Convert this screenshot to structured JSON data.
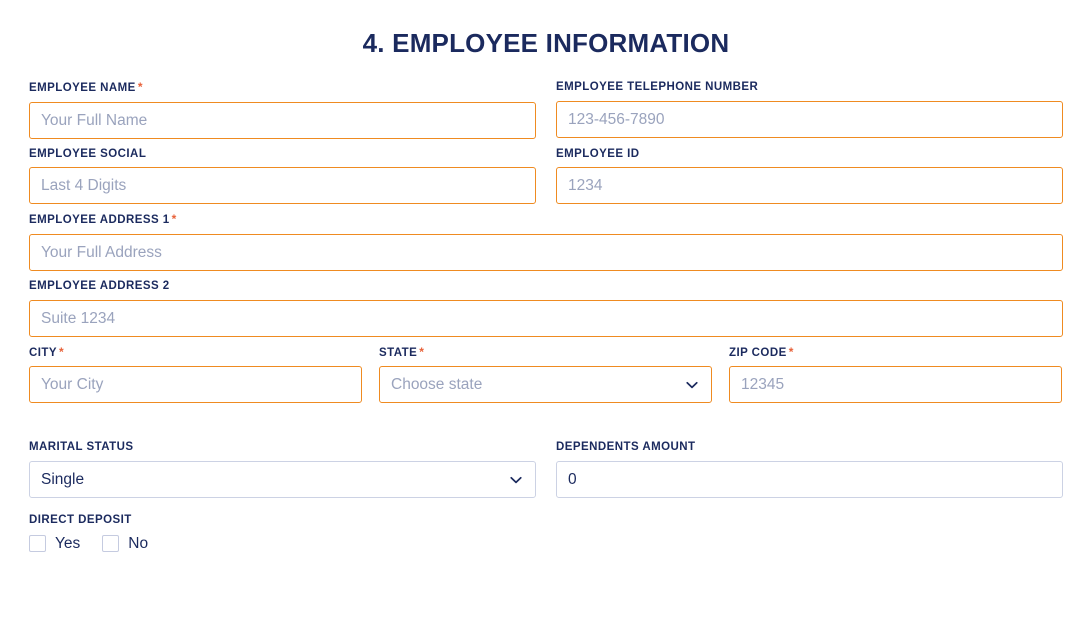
{
  "form": {
    "title": "4. EMPLOYEE INFORMATION",
    "required_marker": "*",
    "colors": {
      "title": "#1b2a5e",
      "label": "#1b2a5e",
      "required_asterisk": "#e8623a",
      "input_border_orange": "#ef8b21",
      "input_border_neutral": "#ccd2e4",
      "placeholder": "#9aa3bd",
      "value_text": "#1b2a5e"
    },
    "rows": [
      {
        "fields": [
          {
            "name": "employee-name",
            "label": "EMPLOYEE NAME",
            "required": true,
            "placeholder": "Your Full Name",
            "value": ""
          },
          {
            "name": "employee-telephone-number",
            "label": "EMPLOYEE TELEPHONE NUMBER",
            "required": false,
            "placeholder": "123-456-7890",
            "value": ""
          }
        ]
      },
      {
        "fields": [
          {
            "name": "employee-social",
            "label": "EMPLOYEE SOCIAL",
            "required": false,
            "placeholder": "Last 4 Digits",
            "value": ""
          },
          {
            "name": "employee-id",
            "label": "EMPLOYEE ID",
            "required": false,
            "placeholder": "1234",
            "value": ""
          }
        ]
      },
      {
        "fields": [
          {
            "name": "employee-address-1",
            "label": "EMPLOYEE ADDRESS 1",
            "required": true,
            "placeholder": "Your Full Address",
            "value": ""
          }
        ]
      },
      {
        "fields": [
          {
            "name": "employee-address-2",
            "label": "EMPLOYEE ADDRESS 2",
            "required": false,
            "placeholder": "Suite 1234",
            "value": ""
          }
        ]
      },
      {
        "fields": [
          {
            "name": "city",
            "label": "CITY",
            "required": true,
            "placeholder": "Your City",
            "value": ""
          },
          {
            "name": "state",
            "label": "STATE",
            "required": true,
            "placeholder": "Choose state",
            "value": ""
          },
          {
            "name": "zip-code",
            "label": "ZIP CODE",
            "required": true,
            "placeholder": "12345",
            "value": ""
          }
        ]
      },
      {
        "fields": [
          {
            "name": "marital-status",
            "label": "MARITAL STATUS",
            "required": false,
            "placeholder": "",
            "value": "Single"
          },
          {
            "name": "dependents-amount",
            "label": "DEPENDENTS AMOUNT",
            "required": false,
            "placeholder": "",
            "value": "0"
          }
        ]
      }
    ],
    "direct_deposit": {
      "label": "DIRECT DEPOSIT",
      "options": [
        {
          "label": "Yes",
          "checked": false
        },
        {
          "label": "No",
          "checked": false
        }
      ]
    },
    "icons": {
      "chevron": "chevron-down-icon"
    }
  }
}
